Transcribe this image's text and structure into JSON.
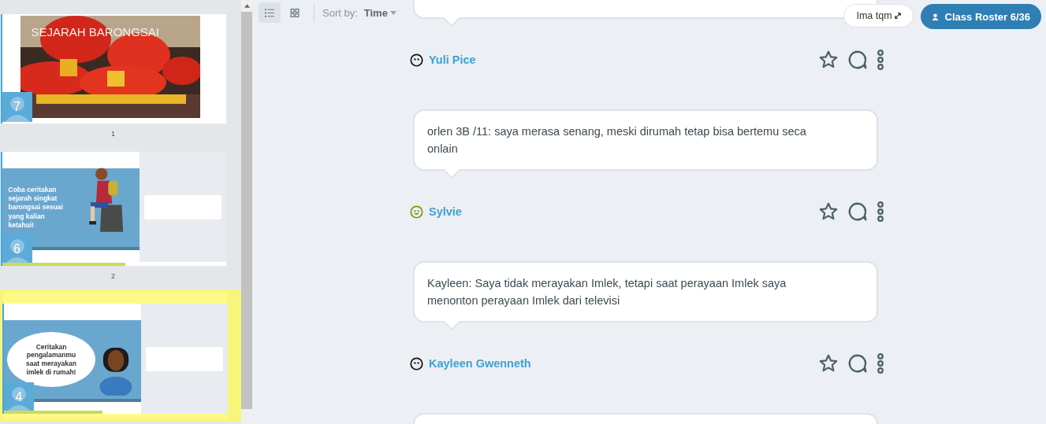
{
  "slides": [
    {
      "title": "SEJARAH BARONGSAI",
      "responses": "7",
      "number": "1",
      "selected": false
    },
    {
      "kind": "prompt",
      "title": "Coba ceritakan sejarah singkat barongsai sesuai yang kalian ketahui!",
      "responses": "6",
      "number": "2",
      "selected": false,
      "level": 0.55
    },
    {
      "kind": "cloud",
      "title": "Ceritakan pengalamanmu saat merayakan imlek di rumah!",
      "responses": "4",
      "selected": true,
      "level": 0.44
    }
  ],
  "toolbar": {
    "views": [
      {
        "kind": "list",
        "selected": true
      },
      {
        "kind": "grid",
        "selected": false
      }
    ],
    "sort_label": "Sort by:",
    "sort_value": "Time"
  },
  "header_buttons": {
    "share": "Ima tqm",
    "roster": "Class Roster 6/36"
  },
  "posts": [
    {
      "kind": "response",
      "author": {
        "name": "Yuli Pice",
        "kind": "neutral"
      },
      "starred": false
    },
    {
      "kind": "response",
      "text": "orlen 3B /11: saya merasa senang, meski dirumah tetap bisa bertemu seca onlain",
      "author": {
        "name": "Sylvie",
        "kind": "happy"
      },
      "starred": false
    },
    {
      "kind": "response",
      "text": "Kayleen: Saya tidak merayakan Imlek, tetapi saat perayaan Imlek saya menonton perayaan Imlek dari televisi",
      "author": {
        "name": "Kayleen Gwenneth",
        "kind": "neutral"
      },
      "starred": false
    },
    {
      "kind": "response"
    }
  ]
}
